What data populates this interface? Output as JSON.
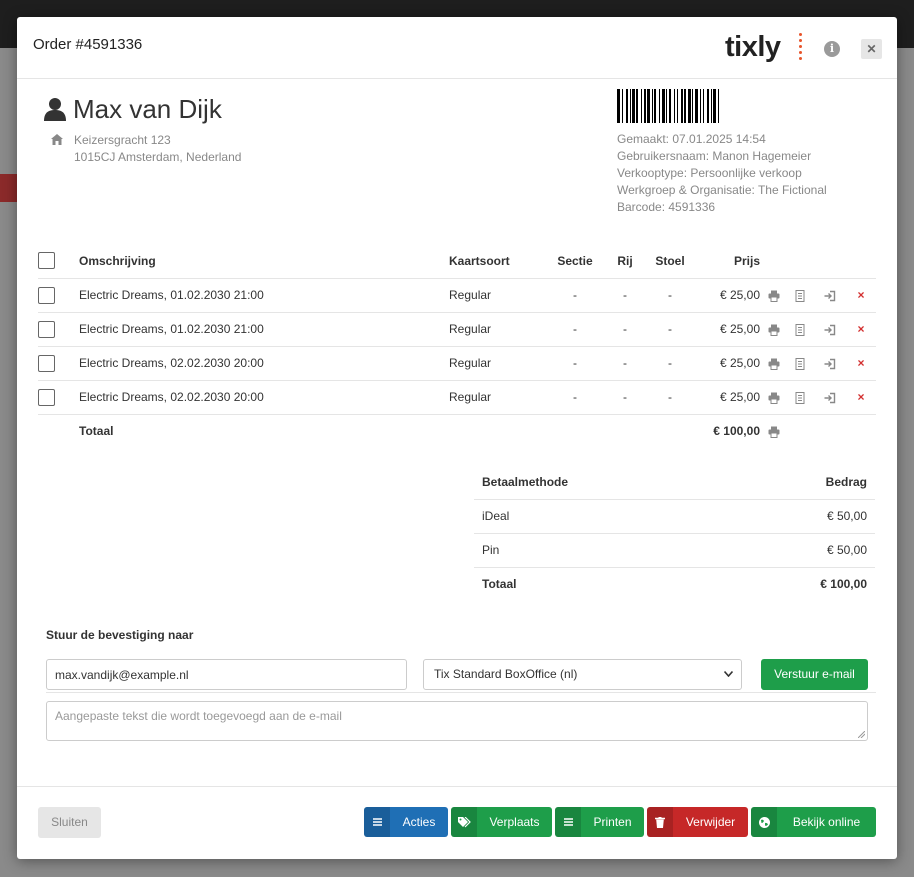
{
  "modal": {
    "title": "Order #4591336",
    "logo": "tixly"
  },
  "customer": {
    "name": "Max van Dijk",
    "street": "Keizersgracht 123",
    "city": "1015CJ Amsterdam, Nederland"
  },
  "meta": {
    "created": "Gemaakt: 07.01.2025 14:54",
    "username": "Gebruikersnaam: Manon Hagemeier",
    "sale_type": "Verkooptype: Persoonlijke verkoop",
    "workgroup": "Werkgroep & Organisatie: The Fictional",
    "barcode": "Barcode: 4591336"
  },
  "tickets": {
    "headers": {
      "description": "Omschrijving",
      "ticket_type": "Kaartsoort",
      "section": "Sectie",
      "row": "Rij",
      "seat": "Stoel",
      "price": "Prijs"
    },
    "rows": [
      {
        "description": "Electric Dreams, 01.02.2030 21:00",
        "ticket_type": "Regular",
        "section": "-",
        "row": "-",
        "seat": "-",
        "price": "€ 25,00"
      },
      {
        "description": "Electric Dreams, 01.02.2030 21:00",
        "ticket_type": "Regular",
        "section": "-",
        "row": "-",
        "seat": "-",
        "price": "€ 25,00"
      },
      {
        "description": "Electric Dreams, 02.02.2030 20:00",
        "ticket_type": "Regular",
        "section": "-",
        "row": "-",
        "seat": "-",
        "price": "€ 25,00"
      },
      {
        "description": "Electric Dreams, 02.02.2030 20:00",
        "ticket_type": "Regular",
        "section": "-",
        "row": "-",
        "seat": "-",
        "price": "€ 25,00"
      }
    ],
    "total_label": "Totaal",
    "total_value": "€ 100,00"
  },
  "payments": {
    "headers": {
      "method": "Betaalmethode",
      "amount": "Bedrag"
    },
    "rows": [
      {
        "method": "iDeal",
        "amount": "€ 50,00"
      },
      {
        "method": "Pin",
        "amount": "€ 50,00"
      }
    ],
    "total_label": "Totaal",
    "total_value": "€ 100,00"
  },
  "confirmation": {
    "label": "Stuur de bevestiging naar",
    "email": "max.vandijk@example.nl",
    "template": "Tix Standard BoxOffice (nl)",
    "send_button": "Verstuur e-mail",
    "custom_text_placeholder": "Aangepaste tekst die wordt toegevoegd aan de e-mail"
  },
  "footer": {
    "close": "Sluiten",
    "actions": "Acties",
    "move": "Verplaats",
    "print": "Printen",
    "delete": "Verwijder",
    "view_online": "Bekijk online"
  },
  "colors": {
    "green": "#1e9e4a",
    "blue": "#1f6fb5",
    "red": "#c62828",
    "logo_accent": "#e8542b"
  }
}
